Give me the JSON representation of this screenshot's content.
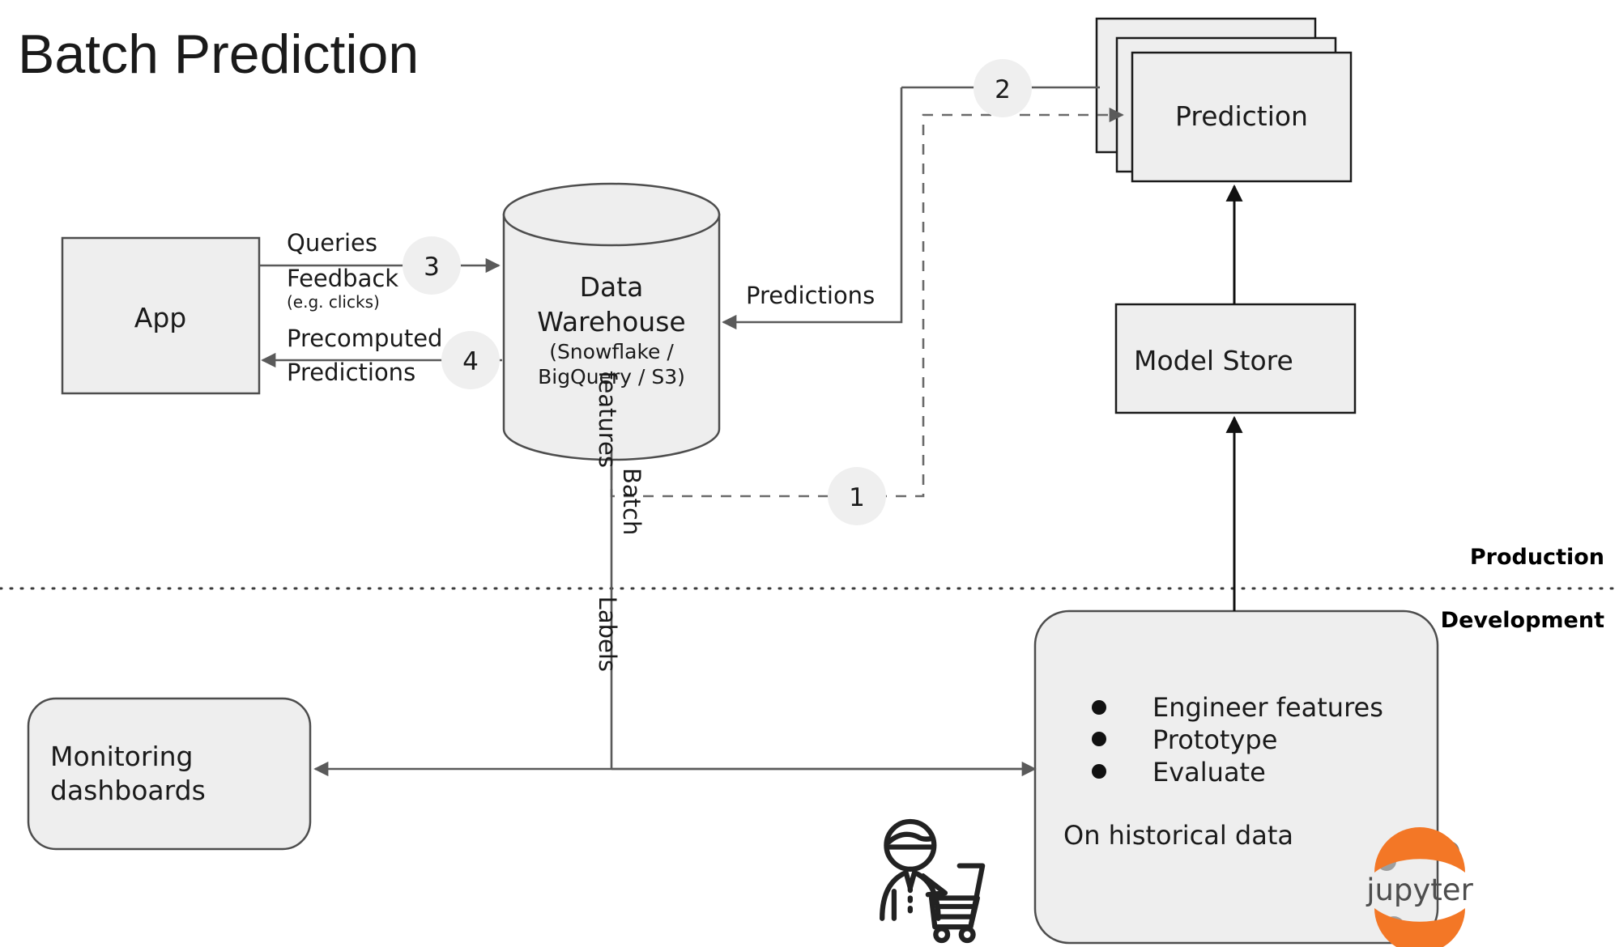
{
  "title": "Batch Prediction",
  "colors": {
    "node_fill": "#eeeeee",
    "node_stroke_dark": "#1a1a1a",
    "node_stroke_mid": "#4d4d4d",
    "edge": "#5a5a5a",
    "badge_fill": "#efefef",
    "text": "#1a1a1a",
    "jupyter_orange": "#f37726",
    "jupyter_gray": "#9e9e9e",
    "divider": "#3a3a3a"
  },
  "nodes": {
    "app": {
      "label": "App"
    },
    "data_warehouse": {
      "label_line1": "Data",
      "label_line2": "Warehouse",
      "sub_line1": "(Snowflake /",
      "sub_line2": "BigQuery / S3)"
    },
    "prediction": {
      "label": "Prediction",
      "stack_count": 3
    },
    "model_store": {
      "label": "Model Store"
    },
    "monitoring": {
      "label_line1": "Monitoring",
      "label_line2": "dashboards"
    },
    "development": {
      "bullets": [
        "Engineer features",
        "Prototype",
        "Evaluate"
      ],
      "footer": "On historical data"
    }
  },
  "edges": {
    "queries": "Queries",
    "feedback": "Feedback",
    "feedback_note": "(e.g. clicks)",
    "precomputed_line1": "Precomputed",
    "precomputed_line2": "Predictions",
    "predictions": "Predictions",
    "batch": "Batch",
    "features": "features",
    "labels": "Labels"
  },
  "badges": [
    {
      "id": "badge-1",
      "label": "1"
    },
    {
      "id": "badge-2",
      "label": "2"
    },
    {
      "id": "badge-3",
      "label": "3"
    },
    {
      "id": "badge-4",
      "label": "4"
    }
  ],
  "zones": {
    "production": "Production",
    "development": "Development"
  },
  "logos": {
    "jupyter_wordmark": "jupyter"
  }
}
